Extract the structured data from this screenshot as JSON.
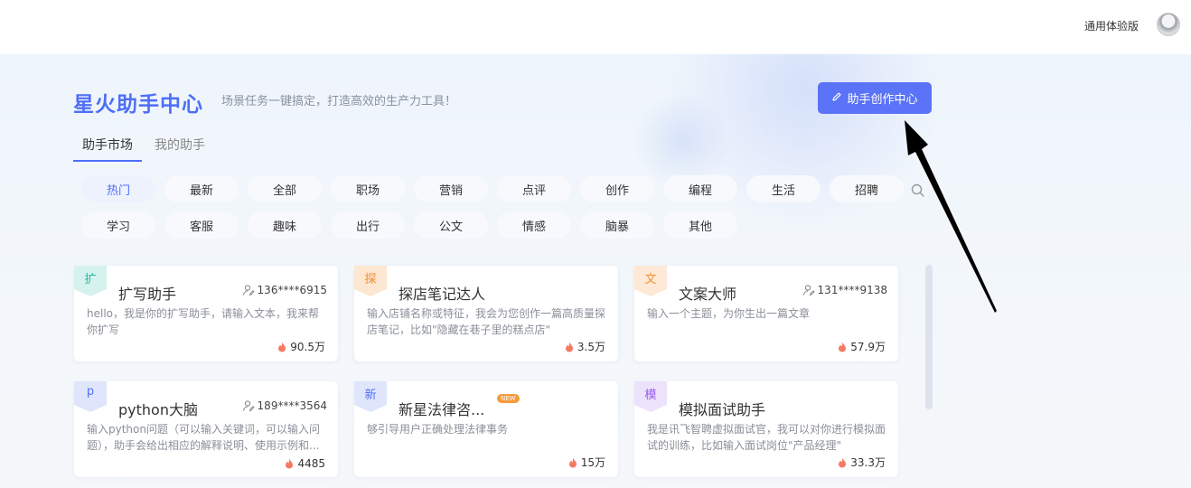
{
  "header": {
    "edition_label": "通用体验版"
  },
  "hero": {
    "title": "星火助手中心",
    "subtitle": "场景任务一键搞定，打造高效的生产力工具！",
    "create_button": "助手创作中心"
  },
  "tabs": [
    {
      "label": "助手市场",
      "active": true
    },
    {
      "label": "我的助手",
      "active": false
    }
  ],
  "categories": {
    "row1": [
      "热门",
      "最新",
      "全部",
      "职场",
      "营销",
      "点评",
      "创作",
      "编程",
      "生活",
      "招聘"
    ],
    "row2": [
      "学习",
      "客服",
      "趣味",
      "出行",
      "公文",
      "情感",
      "脑暴",
      "其他"
    ],
    "active": "热门"
  },
  "cards": [
    {
      "badge": "扩",
      "title": "扩写助手",
      "user": "136****6915",
      "desc": "hello，我是你的扩写助手，请输入文本，我来帮你扩写",
      "count": "90.5万",
      "badge_color": "#d6f2ee",
      "badge_text_color": "#2bb5a2"
    },
    {
      "badge": "探",
      "title": "探店笔记达人",
      "user": "",
      "desc": "输入店铺名称或特征，我会为您创作一篇高质量探店笔记，比如\"隐藏在巷子里的糕点店\"",
      "count": "3.5万",
      "badge_color": "#fde7d2",
      "badge_text_color": "#f08a2c"
    },
    {
      "badge": "文",
      "title": "文案大师",
      "user": "131****9138",
      "desc": "输入一个主题，为你生出一篇文章",
      "count": "57.9万",
      "badge_color": "#fde9d6",
      "badge_text_color": "#f0912f"
    },
    {
      "badge": "p",
      "title": "python大脑",
      "user": "189****3564",
      "desc": "输入python问题（可以输入关键词，可以输入问题），助手会给出相应的解释说明、使用示例和...",
      "count": "4485",
      "badge_color": "#dfe6fb",
      "badge_text_color": "#4f6ef7"
    },
    {
      "badge": "新",
      "title": "新星法律咨...",
      "user": "",
      "desc": "够引导用户正确处理法律事务",
      "count": "15万",
      "badge_color": "#dfe6fb",
      "badge_text_color": "#4f6ef7",
      "tag": "NEW"
    },
    {
      "badge": "模",
      "title": "模拟面试助手",
      "user": "",
      "desc": "我是讯飞智聘虚拟面试官，我可以对你进行模拟面试的训练，比如输入面试岗位\"产品经理\"",
      "count": "33.3万",
      "badge_color": "#ece2fb",
      "badge_text_color": "#9a5cf0"
    }
  ]
}
